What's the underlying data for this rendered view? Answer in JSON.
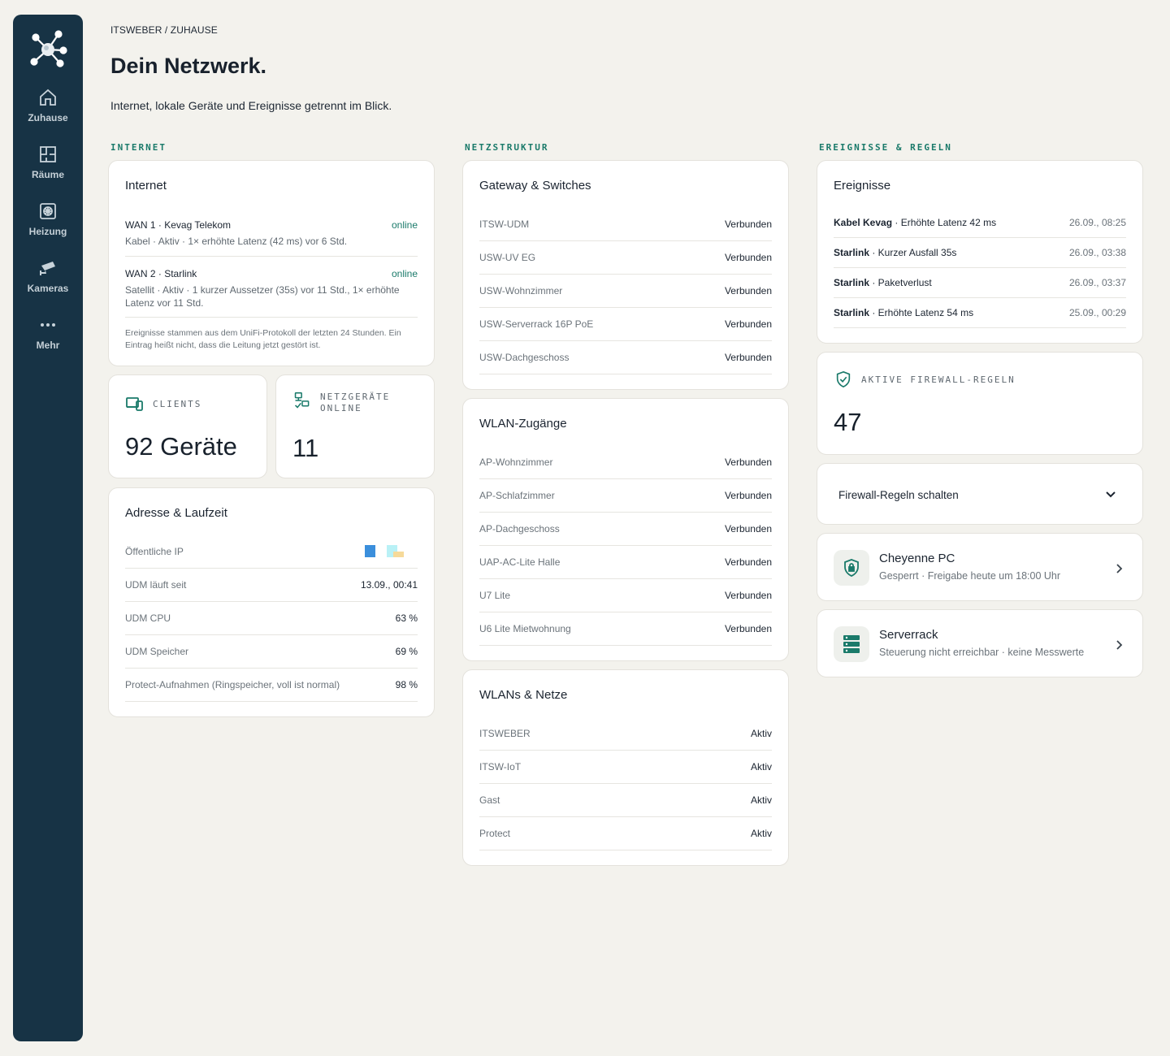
{
  "nav": {
    "items": [
      {
        "label": "Zuhause",
        "icon": "home-icon"
      },
      {
        "label": "Räume",
        "icon": "rooms-icon"
      },
      {
        "label": "Heizung",
        "icon": "heating-icon"
      },
      {
        "label": "Kameras",
        "icon": "camera-icon"
      },
      {
        "label": "Mehr",
        "icon": "more-icon"
      }
    ]
  },
  "header": {
    "breadcrumb": "ITSWEBER / ZUHAUSE",
    "title": "Dein Netzwerk.",
    "subtitle": "Internet, lokale Geräte und Ereignisse getrennt im Blick."
  },
  "sections": {
    "internet": "INTERNET",
    "netzstruktur": "NETZSTRUKTUR",
    "ereignisse": "EREIGNISSE & REGELN"
  },
  "internet": {
    "title": "Internet",
    "wans": [
      {
        "name": "WAN 1 · Kevag Telekom",
        "status": "online",
        "detail": "Kabel · Aktiv · 1× erhöhte Latenz (42 ms) vor 6 Std."
      },
      {
        "name": "WAN 2 · Starlink",
        "status": "online",
        "detail": "Satellit · Aktiv · 1 kurzer Aussetzer (35s) vor 11 Std., 1× erhöhte Latenz vor 11 Std."
      }
    ],
    "note": "Ereignisse stammen aus dem UniFi-Protokoll der letzten 24 Stunden. Ein Eintrag heißt nicht, dass die Leitung jetzt gestört ist."
  },
  "clients": {
    "label": "CLIENTS",
    "value": "92 Geräte"
  },
  "netzgeraete": {
    "label": "NETZGERÄTE ONLINE",
    "value": "11"
  },
  "adresse": {
    "title": "Adresse & Laufzeit",
    "rows": [
      {
        "k": "Öffentliche IP",
        "v": ""
      },
      {
        "k": "UDM läuft seit",
        "v": "13.09., 00:41"
      },
      {
        "k": "UDM CPU",
        "v": "63 %"
      },
      {
        "k": "UDM Speicher",
        "v": "69 %"
      },
      {
        "k": "Protect-Aufnahmen (Ringspeicher, voll ist normal)",
        "v": "98 %"
      }
    ]
  },
  "gateway": {
    "title": "Gateway & Switches",
    "rows": [
      {
        "k": "ITSW-UDM",
        "v": "Verbunden"
      },
      {
        "k": "USW-UV EG",
        "v": "Verbunden"
      },
      {
        "k": "USW-Wohnzimmer",
        "v": "Verbunden"
      },
      {
        "k": "USW-Serverrack 16P PoE",
        "v": "Verbunden"
      },
      {
        "k": "USW-Dachgeschoss",
        "v": "Verbunden"
      }
    ]
  },
  "wlan_ap": {
    "title": "WLAN-Zugänge",
    "rows": [
      {
        "k": "AP-Wohnzimmer",
        "v": "Verbunden"
      },
      {
        "k": "AP-Schlafzimmer",
        "v": "Verbunden"
      },
      {
        "k": "AP-Dachgeschoss",
        "v": "Verbunden"
      },
      {
        "k": "UAP-AC-Lite Halle",
        "v": "Verbunden"
      },
      {
        "k": "U7 Lite",
        "v": "Verbunden"
      },
      {
        "k": "U6 Lite Mietwohnung",
        "v": "Verbunden"
      }
    ]
  },
  "wlans": {
    "title": "WLANs & Netze",
    "rows": [
      {
        "k": "ITSWEBER",
        "v": "Aktiv"
      },
      {
        "k": "ITSW-IoT",
        "v": "Aktiv"
      },
      {
        "k": "Gast",
        "v": "Aktiv"
      },
      {
        "k": "Protect",
        "v": "Aktiv"
      }
    ]
  },
  "events": {
    "title": "Ereignisse",
    "rows": [
      {
        "src": "Kabel Kevag",
        "text": " · Erhöhte Latenz 42 ms",
        "date": "26.09., 08:25"
      },
      {
        "src": "Starlink",
        "text": " · Kurzer Ausfall 35s",
        "date": "26.09., 03:38"
      },
      {
        "src": "Starlink",
        "text": " · Paketverlust",
        "date": "26.09., 03:37"
      },
      {
        "src": "Starlink",
        "text": " · Erhöhte Latenz 54 ms",
        "date": "25.09., 00:29"
      }
    ]
  },
  "firewall": {
    "label": "AKTIVE FIREWALL-REGELN",
    "value": "47"
  },
  "firewall_toggle": {
    "label": "Firewall-Regeln schalten"
  },
  "devices": [
    {
      "name": "Cheyenne PC",
      "sub": "Gesperrt · Freigabe heute um 18:00 Uhr",
      "icon": "shield-lock-icon"
    },
    {
      "name": "Serverrack",
      "sub": "Steuerung nicht erreichbar · keine Messwerte",
      "icon": "server-icon"
    }
  ],
  "colors": {
    "accent": "#1a7a6a",
    "sidebar": "#173345",
    "background": "#f3f2ed"
  }
}
